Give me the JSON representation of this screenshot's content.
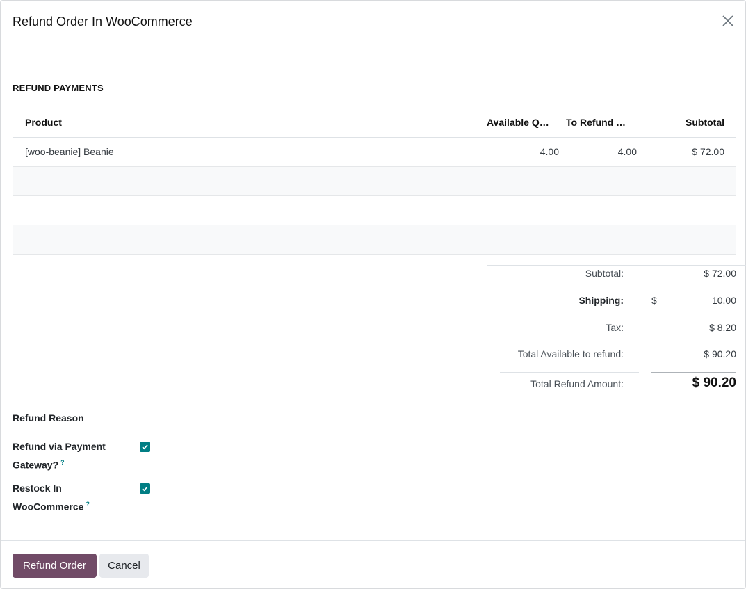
{
  "dialog": {
    "title": "Refund Order In WooCommerce"
  },
  "section": {
    "title": "REFUND PAYMENTS"
  },
  "table": {
    "headers": {
      "product": "Product",
      "available_qty": "Available Q…",
      "to_refund": "To Refund …",
      "subtotal": "Subtotal"
    },
    "rows": [
      {
        "product": "[woo-beanie] Beanie",
        "available_qty": "4.00",
        "to_refund": "4.00",
        "subtotal": "$ 72.00"
      }
    ]
  },
  "totals": {
    "subtotal_label": "Subtotal:",
    "subtotal_value": "$ 72.00",
    "shipping_label": "Shipping:",
    "shipping_currency": "$",
    "shipping_value": "10.00",
    "tax_label": "Tax:",
    "tax_value": "$ 8.20",
    "available_label": "Total Available to refund:",
    "available_value": "$ 90.20",
    "refund_label": "Total Refund Amount:",
    "refund_value": "$ 90.20"
  },
  "form": {
    "refund_reason_label": "Refund Reason",
    "gateway_label_line1": "Refund via Payment",
    "gateway_label_line2": "Gateway?",
    "gateway_checked": true,
    "restock_label_line1": "Restock In",
    "restock_label_line2": "WooCommerce",
    "restock_checked": true,
    "help_marker": "?"
  },
  "footer": {
    "primary_label": "Refund Order",
    "secondary_label": "Cancel"
  },
  "colors": {
    "primary": "#714b67",
    "checkbox": "#017e84"
  },
  "icons": {
    "close": "close-icon",
    "check": "check-icon"
  }
}
